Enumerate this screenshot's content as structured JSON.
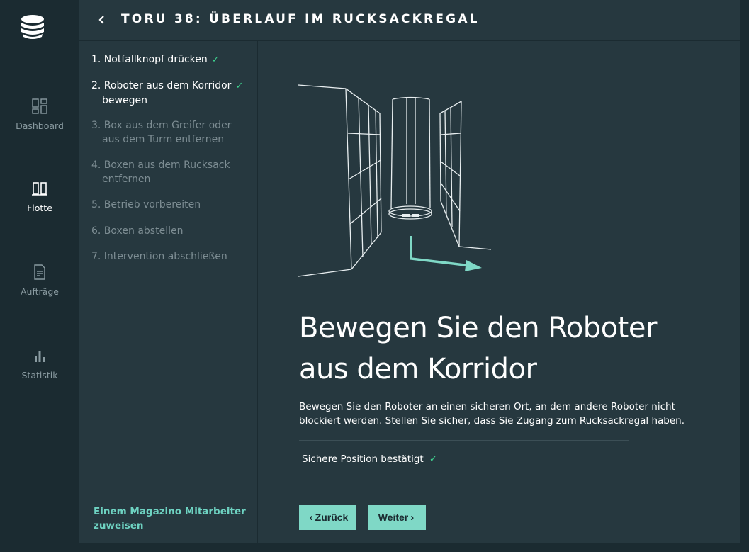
{
  "nav": {
    "items": [
      {
        "label": "Dashboard",
        "icon": "dashboard-icon",
        "active": false
      },
      {
        "label": "Flotte",
        "icon": "fleet-icon",
        "active": true
      },
      {
        "label": "Aufträge",
        "icon": "document-icon",
        "active": false
      },
      {
        "label": "Statistik",
        "icon": "bar-chart-icon",
        "active": false
      }
    ]
  },
  "header": {
    "title": "TORU 38: ÜBERLAUF IM RUCKSACKREGAL"
  },
  "steps": {
    "items": [
      {
        "line1": "1. Notfallknopf drücken",
        "line2": "",
        "done": true
      },
      {
        "line1": "2. Roboter aus dem Korridor",
        "line2": "bewegen",
        "done": true
      },
      {
        "line1": "3. Box aus dem Greifer oder",
        "line2": "aus dem Turm entfernen",
        "done": false
      },
      {
        "line1": "4. Boxen aus dem Rucksack",
        "line2": "entfernen",
        "done": false
      },
      {
        "line1": "5. Betrieb vorbereiten",
        "line2": "",
        "done": false
      },
      {
        "line1": "6. Boxen abstellen",
        "line2": "",
        "done": false
      },
      {
        "line1": "7. Intervention abschließen",
        "line2": "",
        "done": false
      }
    ],
    "check_glyph": "✓",
    "assign_link": "Einem Magazino Mitarbeiter zuweisen"
  },
  "main": {
    "heading": "Bewegen Sie den Roboter aus dem Korridor",
    "description": "Bewegen Sie den Roboter an einen sicheren Ort, an dem andere Roboter nicht blockiert werden. Stellen Sie sicher, dass Sie Zugang zum Rucksackregal haben.",
    "confirmation": "Sichere Position bestätigt",
    "back_button": "Zurück",
    "next_button": "Weiter"
  },
  "colors": {
    "accent": "#7fd8c6",
    "check": "#3ecf8e",
    "panel": "#26383f",
    "background": "#1b2b31"
  }
}
